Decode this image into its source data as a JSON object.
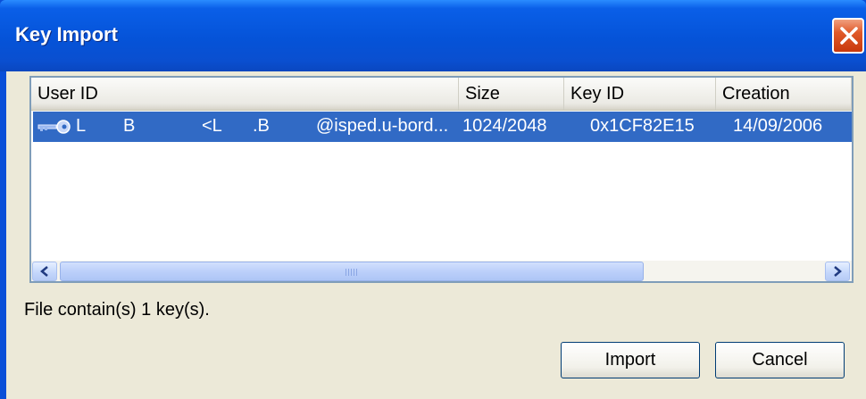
{
  "window": {
    "title": "Key Import"
  },
  "list": {
    "columns": [
      {
        "label": "User ID"
      },
      {
        "label": "Size"
      },
      {
        "label": "Key ID"
      },
      {
        "label": "Creation"
      }
    ],
    "rows": [
      {
        "icon": "key-icon",
        "user_id_parts": [
          "L",
          "B",
          "<L",
          ".B",
          "@isped.u-bord..."
        ],
        "size": "1024/2048",
        "key_id": "0x1CF82E15",
        "creation": "14/09/2006"
      }
    ]
  },
  "status_text": "File contain(s) 1 key(s).",
  "buttons": {
    "import": "Import",
    "cancel": "Cancel"
  },
  "colors": {
    "title_bar": "#0553d8",
    "selection": "#316ac5",
    "dialog_bg": "#ece9d8",
    "close_button": "#e05a2a"
  }
}
